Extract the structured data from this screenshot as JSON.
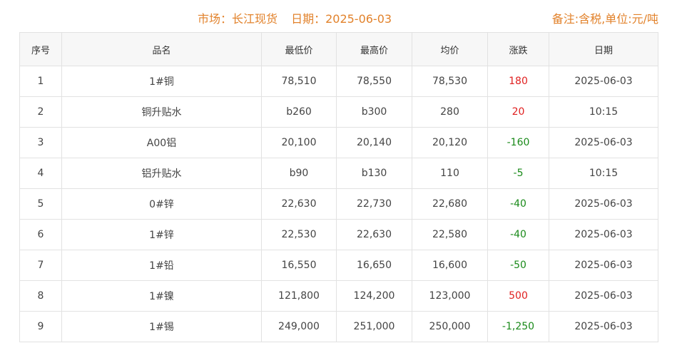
{
  "header": {
    "market_label": "市场：",
    "market_value": "长江现货",
    "date_label": "日期：",
    "date_value": "2025-06-03",
    "note": "备注:含税,单位:元/吨"
  },
  "colors": {
    "accent": "#e2822b",
    "up": "#e02020",
    "down": "#1a8a1a"
  },
  "table": {
    "columns": [
      "序号",
      "品名",
      "最低价",
      "最高价",
      "均价",
      "涨跌",
      "日期"
    ],
    "rows": [
      {
        "no": "1",
        "name": "1#铜",
        "low": "78,510",
        "high": "78,550",
        "avg": "78,530",
        "change": "180",
        "trend": "up",
        "date": "2025-06-03"
      },
      {
        "no": "2",
        "name": "铜升贴水",
        "low": "b260",
        "high": "b300",
        "avg": "280",
        "change": "20",
        "trend": "up",
        "date": "10:15"
      },
      {
        "no": "3",
        "name": "A00铝",
        "low": "20,100",
        "high": "20,140",
        "avg": "20,120",
        "change": "-160",
        "trend": "down",
        "date": "2025-06-03"
      },
      {
        "no": "4",
        "name": "铝升贴水",
        "low": "b90",
        "high": "b130",
        "avg": "110",
        "change": "-5",
        "trend": "down",
        "date": "10:15"
      },
      {
        "no": "5",
        "name": "0#锌",
        "low": "22,630",
        "high": "22,730",
        "avg": "22,680",
        "change": "-40",
        "trend": "down",
        "date": "2025-06-03"
      },
      {
        "no": "6",
        "name": "1#锌",
        "low": "22,530",
        "high": "22,630",
        "avg": "22,580",
        "change": "-40",
        "trend": "down",
        "date": "2025-06-03"
      },
      {
        "no": "7",
        "name": "1#铅",
        "low": "16,550",
        "high": "16,650",
        "avg": "16,600",
        "change": "-50",
        "trend": "down",
        "date": "2025-06-03"
      },
      {
        "no": "8",
        "name": "1#镍",
        "low": "121,800",
        "high": "124,200",
        "avg": "123,000",
        "change": "500",
        "trend": "up",
        "date": "2025-06-03"
      },
      {
        "no": "9",
        "name": "1#锡",
        "low": "249,000",
        "high": "251,000",
        "avg": "250,000",
        "change": "-1,250",
        "trend": "down",
        "date": "2025-06-03"
      }
    ]
  }
}
